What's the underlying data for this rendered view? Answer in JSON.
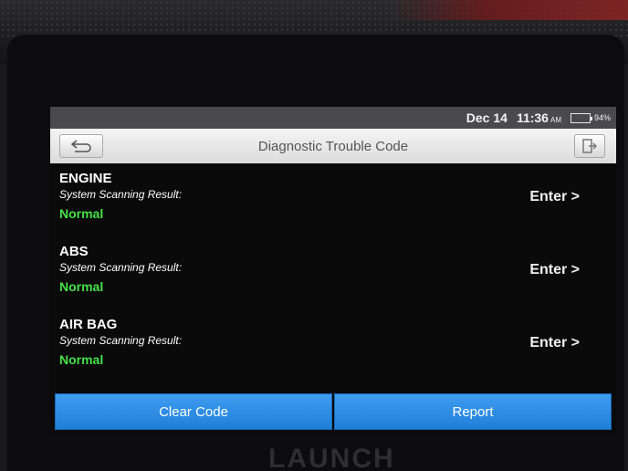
{
  "status_bar": {
    "date": "Dec 14",
    "time": "11:36",
    "ampm": "AM",
    "battery_percent": "94%",
    "battery_level": 0.94
  },
  "header": {
    "title": "Diagnostic Trouble Code",
    "back_icon": "back-arrow-icon",
    "exit_icon": "exit-icon"
  },
  "systems": [
    {
      "name": "ENGINE",
      "subtitle": "System Scanning Result:",
      "status": "Normal",
      "action": "Enter >"
    },
    {
      "name": "ABS",
      "subtitle": "System Scanning Result:",
      "status": "Normal",
      "action": "Enter >"
    },
    {
      "name": "AIR BAG",
      "subtitle": "System Scanning Result:",
      "status": "Normal",
      "action": "Enter >"
    }
  ],
  "footer": {
    "clear_label": "Clear Code",
    "report_label": "Report"
  },
  "device": {
    "brand": "LAUNCH"
  },
  "colors": {
    "status_ok": "#46e046",
    "button_blue": "#2a8ee6",
    "title_bar": "#e8e8e8"
  }
}
